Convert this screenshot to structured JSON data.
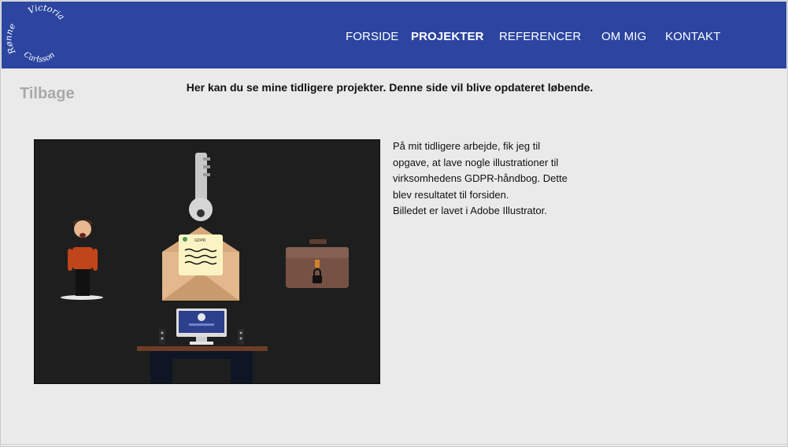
{
  "header": {
    "logo_text_top": "Victoria",
    "logo_text_left": "Rønne",
    "logo_text_bottom": "Carlsson",
    "nav": [
      {
        "label": "FORSIDE",
        "active": false
      },
      {
        "label": "PROJEKTER",
        "active": true
      },
      {
        "label": "REFERENCER",
        "active": false
      },
      {
        "label": "OM MIG",
        "active": false
      },
      {
        "label": "KONTAKT",
        "active": false
      }
    ]
  },
  "page": {
    "back_label": "Tilbage",
    "intro": "Her kan du se mine tidligere projekter. Denne side vil blive opdateret løbende."
  },
  "project": {
    "description_lines": [
      "På mit tidligere arbejde, fik jeg til",
      "opgave, at lave nogle illustrationer til",
      "virksomhedens GDPR-håndbog. Dette",
      "blev resultatet til forsiden.",
      "Billedet er lavet i Adobe Illustrator."
    ],
    "image_letter_label": "GDPR"
  },
  "colors": {
    "header_bg": "#2b45a0",
    "page_bg": "#ebeaea",
    "image_bg": "#1e1e1e"
  }
}
